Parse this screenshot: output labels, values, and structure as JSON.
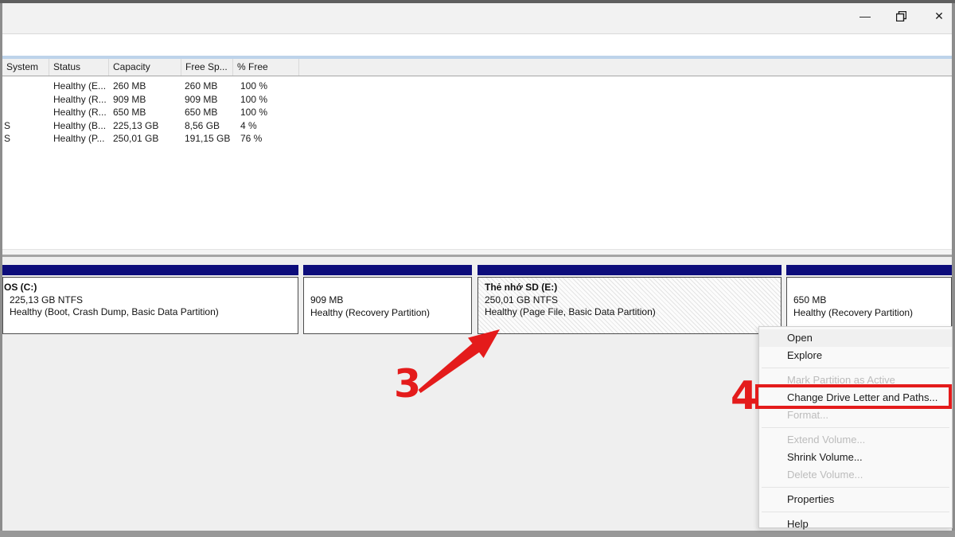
{
  "window": {
    "buttons": {
      "minimize_glyph": "—",
      "close_glyph": "✕"
    }
  },
  "volume_list": {
    "columns": [
      "System",
      "Status",
      "Capacity",
      "Free Sp...",
      "% Free"
    ],
    "rows": [
      {
        "left": "",
        "status": "Healthy (E...",
        "capacity": "260 MB",
        "free": "260 MB",
        "pct": "100 %"
      },
      {
        "left": "",
        "status": "Healthy (R...",
        "capacity": "909 MB",
        "free": "909 MB",
        "pct": "100 %"
      },
      {
        "left": "",
        "status": "Healthy (R...",
        "capacity": "650 MB",
        "free": "650 MB",
        "pct": "100 %"
      },
      {
        "left": "S",
        "status": "Healthy (B...",
        "capacity": "225,13 GB",
        "free": "8,56 GB",
        "pct": "4 %"
      },
      {
        "left": "S",
        "status": "Healthy (P...",
        "capacity": "250,01 GB",
        "free": "191,15 GB",
        "pct": "76 %"
      }
    ]
  },
  "partitions": [
    {
      "title": "OS  (C:)",
      "size": "225,13 GB NTFS",
      "status": "Healthy (Boot, Crash Dump, Basic Data Partition)"
    },
    {
      "title": "",
      "size": "909 MB",
      "status": "Healthy (Recovery Partition)"
    },
    {
      "title": "Thẻ nhớ SD  (E:)",
      "size": "250,01 GB NTFS",
      "status": "Healthy (Page File, Basic Data Partition)"
    },
    {
      "title": "",
      "size": "650 MB",
      "status": "Healthy (Recovery Partition)"
    }
  ],
  "context_menu": {
    "items": [
      {
        "label": "Open"
      },
      {
        "label": "Explore"
      },
      {
        "label": "Mark Partition as Active"
      },
      {
        "label": "Change Drive Letter and Paths..."
      },
      {
        "label": "Format..."
      },
      {
        "label": "Extend Volume..."
      },
      {
        "label": "Shrink Volume..."
      },
      {
        "label": "Delete Volume..."
      },
      {
        "label": "Properties"
      },
      {
        "label": "Help"
      }
    ]
  },
  "annotations": {
    "step3_label": "3",
    "step4_label": "4",
    "highlight_color": "#e41b1b"
  },
  "colors": {
    "partition_bar": "#0d0d7b",
    "pane_accent": "#bdd3ea",
    "annotation_red": "#e41b1b"
  }
}
